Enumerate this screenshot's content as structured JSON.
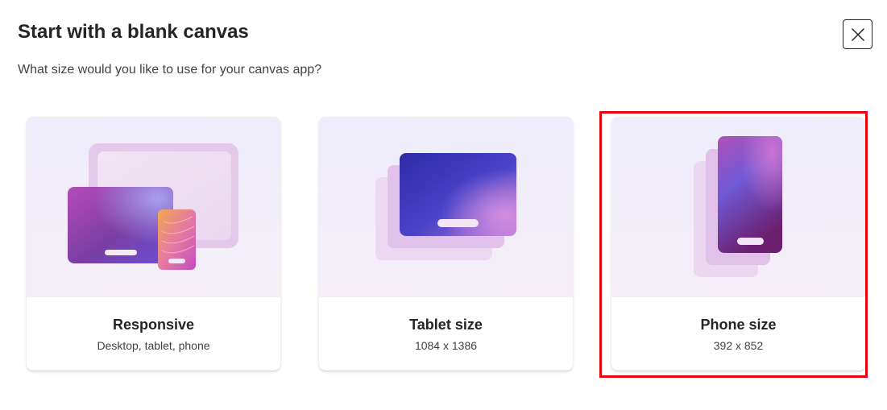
{
  "dialog": {
    "title": "Start with a blank canvas",
    "subtitle": "What size would you like to use for your canvas app?",
    "close_icon": "close-icon"
  },
  "options": [
    {
      "label": "Responsive",
      "description": "Desktop, tablet, phone",
      "selected": false
    },
    {
      "label": "Tablet size",
      "description": "1084 x 1386",
      "selected": false
    },
    {
      "label": "Phone size",
      "description": "392 x 852",
      "selected": true
    }
  ],
  "colors": {
    "selection_outline": "#e8000b",
    "accent_purple": "#8a2aa8",
    "accent_blue": "#3a33b5"
  }
}
